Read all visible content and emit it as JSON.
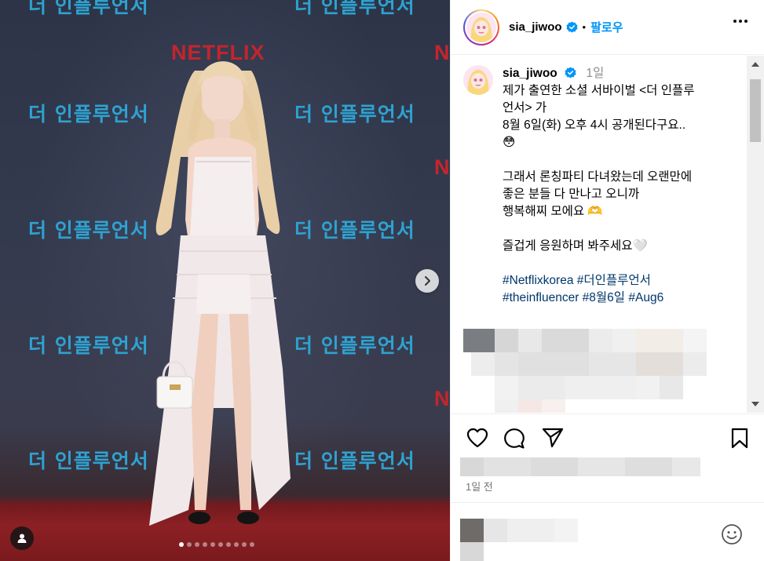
{
  "post": {
    "username": "sia_jiwoo",
    "follow_label": "팔로우",
    "bullet": "•",
    "caption_time": "1일",
    "caption_lines": [
      "제가 출연한 소셜 서바이벌 <더 인플루",
      "언서> 가",
      "8월 6일(화) 오후 4시 공개된다구요..",
      "😳"
    ],
    "caption_lines_2": [
      "그래서 론칭파티 다녀왔는데 오랜만에",
      "좋은 분들 다 만나고 오니까",
      "행복해찌 모에요 🫶"
    ],
    "caption_lines_3": [
      "즐겁게 응원하며 봐주세요🤍"
    ],
    "hashtags_line1": "#Netflixkorea #더인플루언서",
    "hashtags_line2": "#theinfluencer #8월6일 #Aug6",
    "time_ago": "1일 전"
  },
  "media": {
    "backdrop_logo": "더 인플루언서",
    "brand": "NETFLIX",
    "slide_count": 10,
    "active_slide": 1
  },
  "icons": {
    "like": "heart-icon",
    "comment": "comment-icon",
    "share": "send-icon",
    "save": "bookmark-icon",
    "emoji": "smiley-icon",
    "tagged": "user-icon",
    "more": "more-icon",
    "next": "chevron-right-icon",
    "verified": "verified-badge-icon"
  },
  "colors": {
    "follow": "#0095f6",
    "hashtag": "#00376b",
    "verified": "#0095f6",
    "logo": "#2ea8d8",
    "netflix": "#c4252b"
  }
}
